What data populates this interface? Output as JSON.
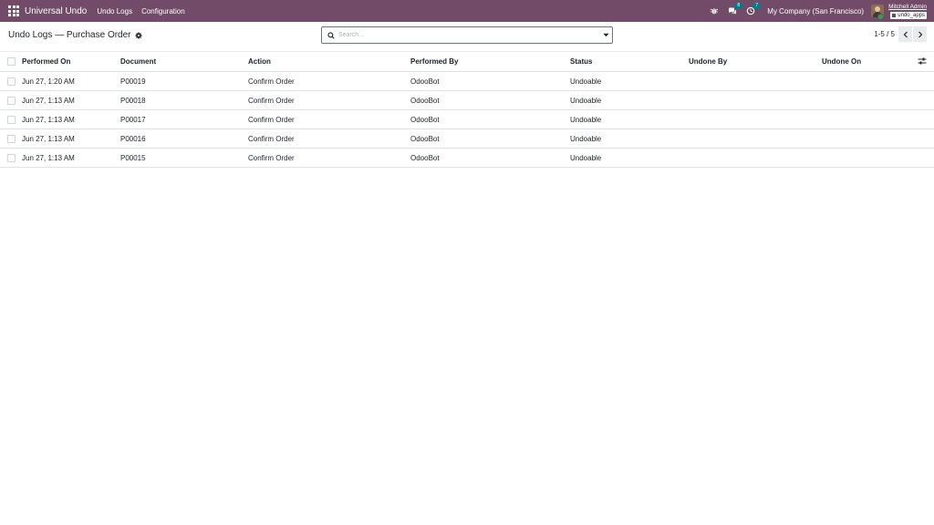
{
  "navbar": {
    "app_name": "Universal Undo",
    "menu": [
      "Undo Logs",
      "Configuration"
    ],
    "icons": [
      "bug-icon",
      "chat-icon",
      "clock-icon"
    ],
    "messages_badge": "8",
    "activities_badge": "7",
    "company": "My Company (San Francisco)",
    "user_name": "Mitchell Admin",
    "database": "undo_apps",
    "bar_color": "#714B67"
  },
  "control": {
    "breadcrumb": "Undo Logs — Purchase Order",
    "search_placeholder": "Search...",
    "pager": "1-5 / 5"
  },
  "table": {
    "columns": [
      "Performed On",
      "Document",
      "Action",
      "Performed By",
      "Status",
      "Undone By",
      "Undone On"
    ],
    "rows": [
      {
        "performed_on": "Jun 27, 1:20 AM",
        "document": "P00019",
        "action": "Confirm Order",
        "performed_by": "OdooBot",
        "status": "Undoable",
        "undone_by": "",
        "undone_on": ""
      },
      {
        "performed_on": "Jun 27, 1:13 AM",
        "document": "P00018",
        "action": "Confirm Order",
        "performed_by": "OdooBot",
        "status": "Undoable",
        "undone_by": "",
        "undone_on": ""
      },
      {
        "performed_on": "Jun 27, 1:13 AM",
        "document": "P00017",
        "action": "Confirm Order",
        "performed_by": "OdooBot",
        "status": "Undoable",
        "undone_by": "",
        "undone_on": ""
      },
      {
        "performed_on": "Jun 27, 1:13 AM",
        "document": "P00016",
        "action": "Confirm Order",
        "performed_by": "OdooBot",
        "status": "Undoable",
        "undone_by": "",
        "undone_on": ""
      },
      {
        "performed_on": "Jun 27, 1:13 AM",
        "document": "P00015",
        "action": "Confirm Order",
        "performed_by": "OdooBot",
        "status": "Undoable",
        "undone_by": "",
        "undone_on": ""
      }
    ]
  }
}
